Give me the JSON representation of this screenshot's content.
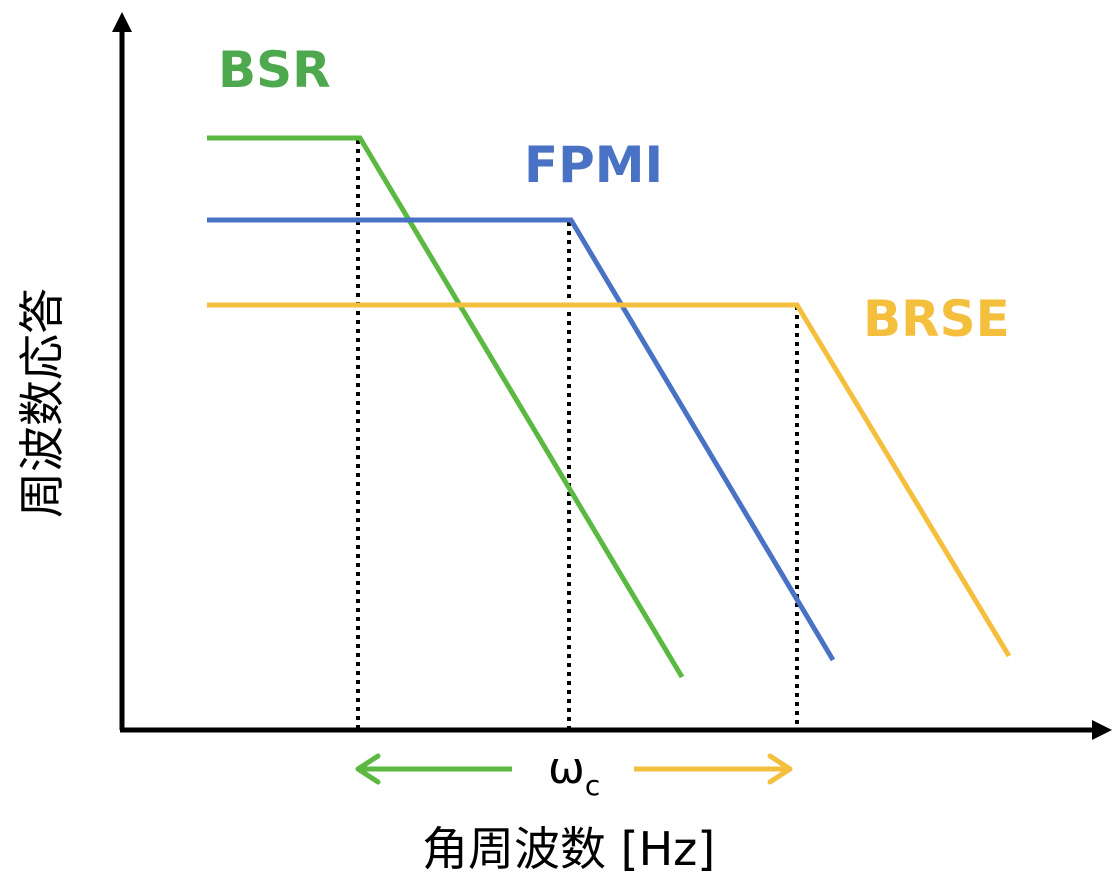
{
  "labels": {
    "bsr": "BSR",
    "fpmi": "FPMI",
    "brse": "BRSE",
    "x_axis": "角周波数 [Hz]",
    "y_axis": "周波数応答",
    "omega": "ω",
    "omega_sub": "c"
  },
  "colors": {
    "bsr": "#5bb840",
    "fpmi": "#4a72c4",
    "brse": "#f5bf3e",
    "bsr_label": "#4ea84e",
    "axis": "#000000"
  }
}
